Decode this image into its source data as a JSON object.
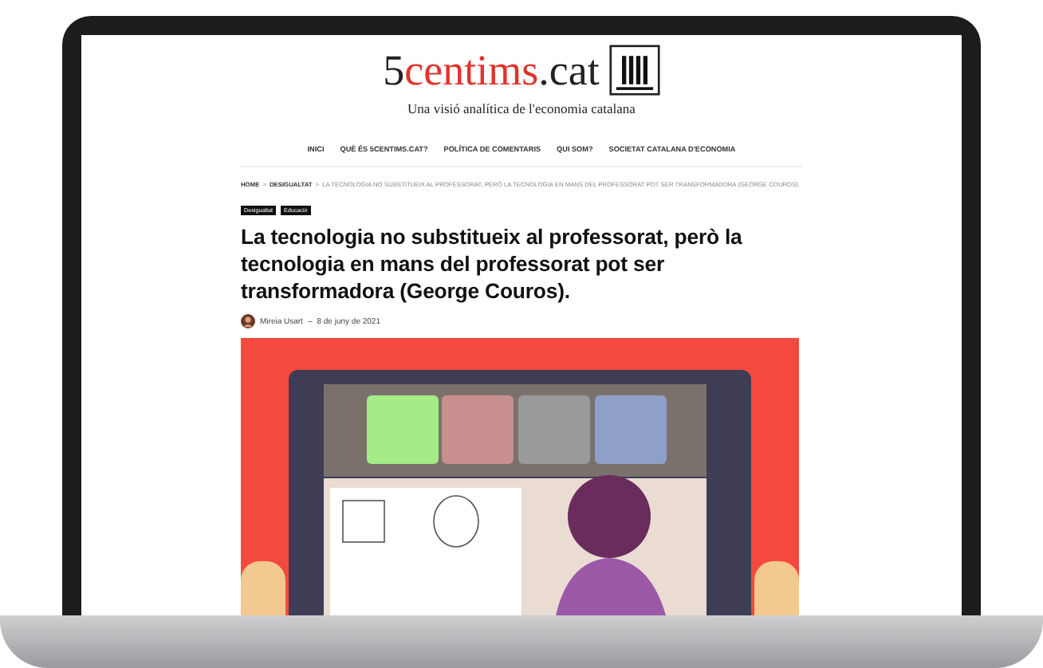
{
  "site": {
    "logo_number": "5",
    "logo_name": "centims",
    "logo_tld": ".cat",
    "tagline": "Una visió analítica de l'economia catalana"
  },
  "nav": [
    {
      "label": "INICI"
    },
    {
      "label": "QUÈ ÉS 5CENTIMS.CAT?"
    },
    {
      "label": "POLÍTICA DE COMENTARIS"
    },
    {
      "label": "QUI SOM?"
    },
    {
      "label": "SOCIETAT CATALANA D'ECONOMIA"
    }
  ],
  "breadcrumb": [
    {
      "label": "HOME",
      "kind": "link"
    },
    {
      "label": "DESIGUALTAT",
      "kind": "link"
    },
    {
      "label": "LA TECNOLOGIA NO SUBSTITUEIX AL PROFESSORAT, PERÒ LA TECNOLOGIA EN MANS DEL PROFESSORAT POT SER TRANSFORMADORA (GEORGE COUROS).",
      "kind": "current"
    }
  ],
  "breadcrumb_separator": ">",
  "tags": [
    "Desigualtat",
    "Educació"
  ],
  "article": {
    "title": "La tecnologia no substitueix al professorat, però la tecnologia en mans del professorat pot ser transformadora (George Couros).",
    "author": "Mireia Usart",
    "date_separator": "–",
    "date": "8 de juny de 2021"
  }
}
